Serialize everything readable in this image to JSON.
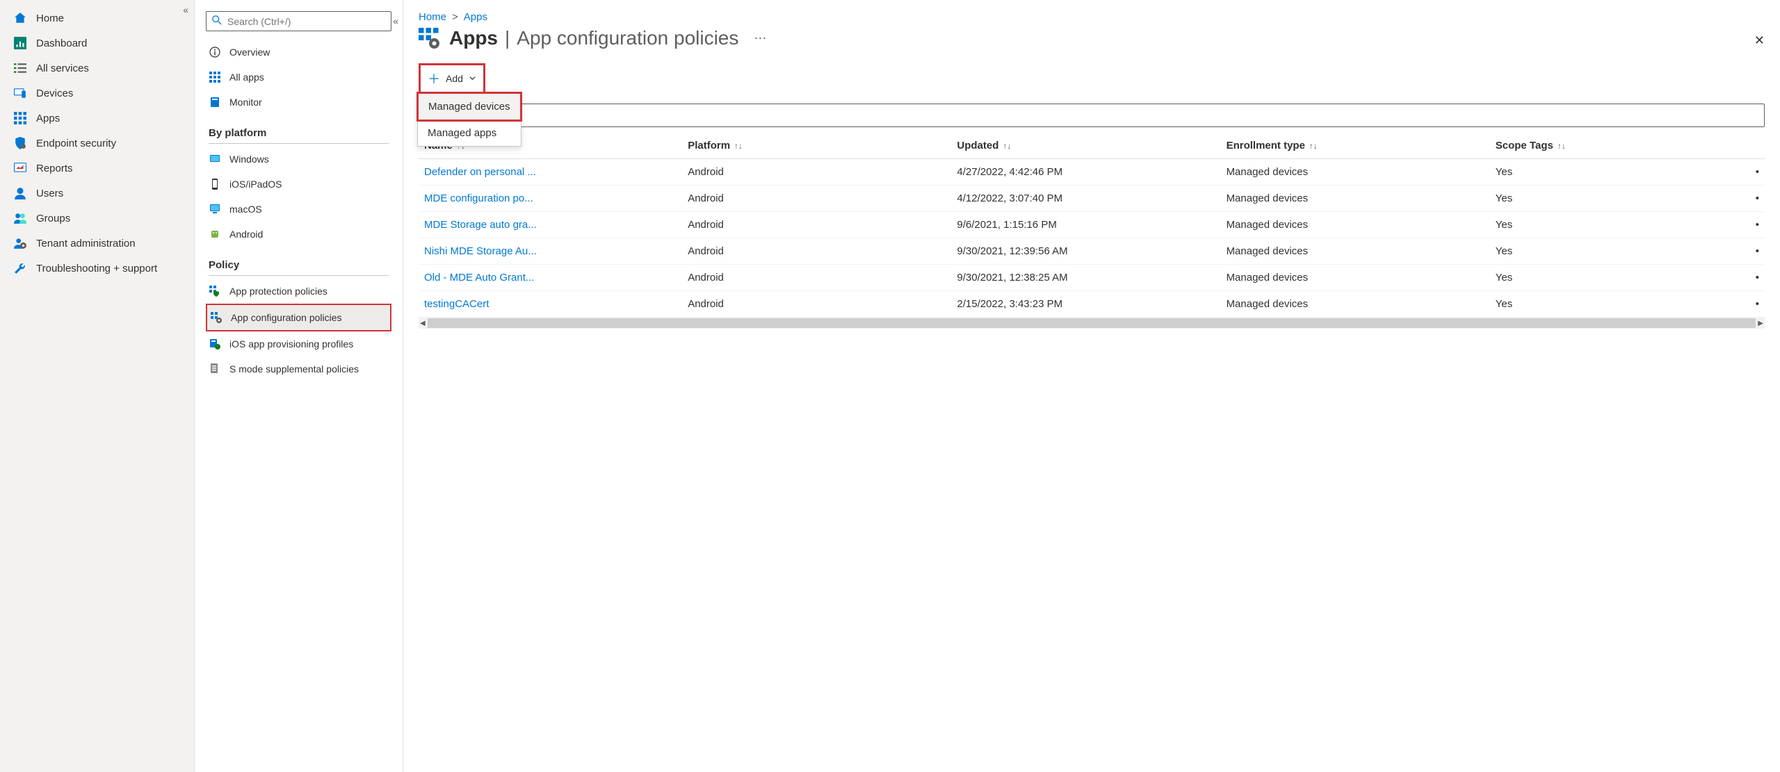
{
  "breadcrumb": {
    "home": "Home",
    "apps": "Apps"
  },
  "header": {
    "title_main": "Apps",
    "title_sub": "App configuration policies"
  },
  "left_nav": {
    "items": [
      {
        "label": "Home"
      },
      {
        "label": "Dashboard"
      },
      {
        "label": "All services"
      },
      {
        "label": "Devices"
      },
      {
        "label": "Apps"
      },
      {
        "label": "Endpoint security"
      },
      {
        "label": "Reports"
      },
      {
        "label": "Users"
      },
      {
        "label": "Groups"
      },
      {
        "label": "Tenant administration"
      },
      {
        "label": "Troubleshooting + support"
      }
    ]
  },
  "search": {
    "placeholder": "Search (Ctrl+/)"
  },
  "sub_nav": {
    "top": [
      {
        "label": "Overview"
      },
      {
        "label": "All apps"
      },
      {
        "label": "Monitor"
      }
    ],
    "by_platform_title": "By platform",
    "by_platform": [
      {
        "label": "Windows"
      },
      {
        "label": "iOS/iPadOS"
      },
      {
        "label": "macOS"
      },
      {
        "label": "Android"
      }
    ],
    "policy_title": "Policy",
    "policy": [
      {
        "label": "App protection policies"
      },
      {
        "label": "App configuration policies"
      },
      {
        "label": "iOS app provisioning profiles"
      },
      {
        "label": "S mode supplemental policies"
      }
    ]
  },
  "toolbar": {
    "add_label": "Add",
    "dropdown": [
      "Managed devices",
      "Managed apps"
    ]
  },
  "table": {
    "headers": {
      "name": "Name",
      "platform": "Platform",
      "updated": "Updated",
      "enrollment": "Enrollment type",
      "scope": "Scope Tags"
    },
    "rows": [
      {
        "name": "Defender on personal ...",
        "platform": "Android",
        "updated": "4/27/2022, 4:42:46 PM",
        "enrollment": "Managed devices",
        "scope": "Yes"
      },
      {
        "name": "MDE configuration po...",
        "platform": "Android",
        "updated": "4/12/2022, 3:07:40 PM",
        "enrollment": "Managed devices",
        "scope": "Yes"
      },
      {
        "name": "MDE Storage auto gra...",
        "platform": "Android",
        "updated": "9/6/2021, 1:15:16 PM",
        "enrollment": "Managed devices",
        "scope": "Yes"
      },
      {
        "name": "Nishi MDE Storage Au...",
        "platform": "Android",
        "updated": "9/30/2021, 12:39:56 AM",
        "enrollment": "Managed devices",
        "scope": "Yes"
      },
      {
        "name": "Old - MDE Auto Grant...",
        "platform": "Android",
        "updated": "9/30/2021, 12:38:25 AM",
        "enrollment": "Managed devices",
        "scope": "Yes"
      },
      {
        "name": "testingCACert",
        "platform": "Android",
        "updated": "2/15/2022, 3:43:23 PM",
        "enrollment": "Managed devices",
        "scope": "Yes"
      }
    ]
  }
}
